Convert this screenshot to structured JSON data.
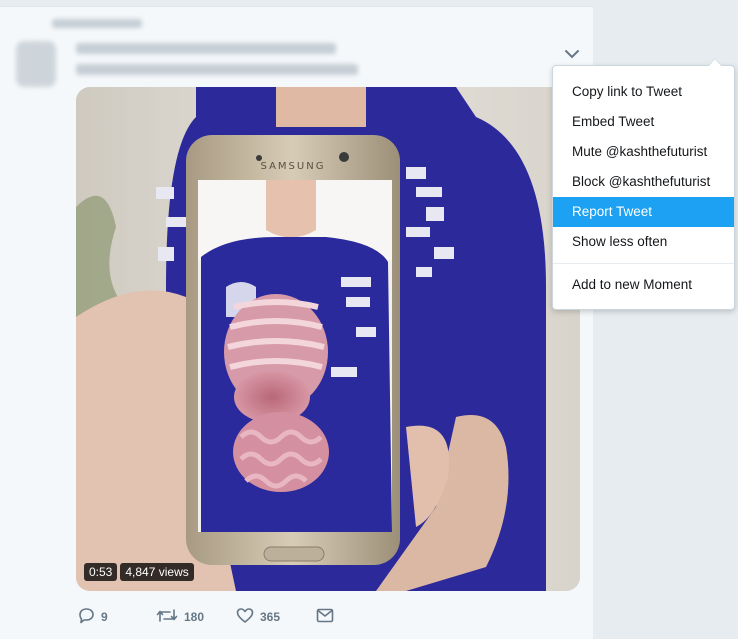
{
  "menu": {
    "items": [
      {
        "label": "Copy link to Tweet"
      },
      {
        "label": "Embed Tweet"
      },
      {
        "label": "Mute @kashthefuturist"
      },
      {
        "label": "Block @kashthefuturist"
      },
      {
        "label": "Report Tweet"
      },
      {
        "label": "Show less often"
      }
    ],
    "extra": {
      "label": "Add to new Moment"
    },
    "highlight_color": "#1da1f2"
  },
  "media": {
    "duration": "0:53",
    "views": "4,847 views",
    "phone_brand": "SAMSUNG"
  },
  "actions": {
    "reply_count": "9",
    "retweet_count": "180",
    "like_count": "365"
  },
  "icons": [
    "caret-down-icon",
    "reply-icon",
    "retweet-icon",
    "like-icon",
    "message-icon"
  ],
  "colors": {
    "accent": "#1da1f2",
    "muted": "#657786",
    "background": "#e6ecf0"
  }
}
